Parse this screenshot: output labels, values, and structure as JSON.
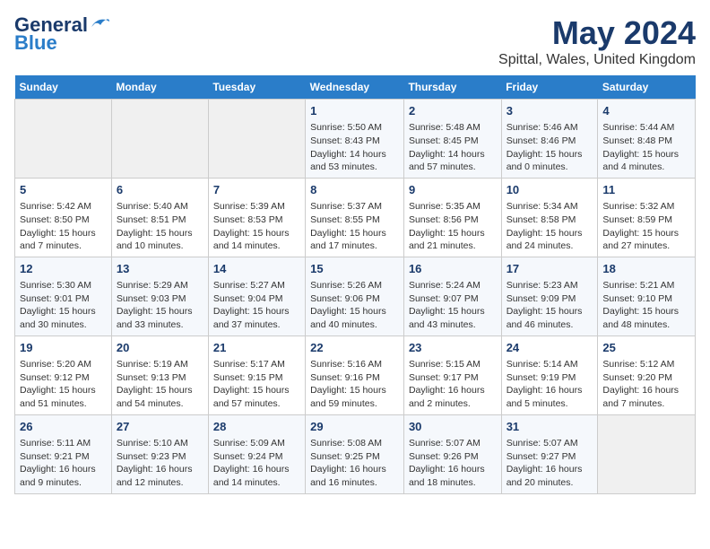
{
  "logo": {
    "line1": "General",
    "line2": "Blue"
  },
  "title": "May 2024",
  "subtitle": "Spittal, Wales, United Kingdom",
  "headers": [
    "Sunday",
    "Monday",
    "Tuesday",
    "Wednesday",
    "Thursday",
    "Friday",
    "Saturday"
  ],
  "weeks": [
    [
      {
        "day": "",
        "info": ""
      },
      {
        "day": "",
        "info": ""
      },
      {
        "day": "",
        "info": ""
      },
      {
        "day": "1",
        "info": "Sunrise: 5:50 AM\nSunset: 8:43 PM\nDaylight: 14 hours and 53 minutes."
      },
      {
        "day": "2",
        "info": "Sunrise: 5:48 AM\nSunset: 8:45 PM\nDaylight: 14 hours and 57 minutes."
      },
      {
        "day": "3",
        "info": "Sunrise: 5:46 AM\nSunset: 8:46 PM\nDaylight: 15 hours and 0 minutes."
      },
      {
        "day": "4",
        "info": "Sunrise: 5:44 AM\nSunset: 8:48 PM\nDaylight: 15 hours and 4 minutes."
      }
    ],
    [
      {
        "day": "5",
        "info": "Sunrise: 5:42 AM\nSunset: 8:50 PM\nDaylight: 15 hours and 7 minutes."
      },
      {
        "day": "6",
        "info": "Sunrise: 5:40 AM\nSunset: 8:51 PM\nDaylight: 15 hours and 10 minutes."
      },
      {
        "day": "7",
        "info": "Sunrise: 5:39 AM\nSunset: 8:53 PM\nDaylight: 15 hours and 14 minutes."
      },
      {
        "day": "8",
        "info": "Sunrise: 5:37 AM\nSunset: 8:55 PM\nDaylight: 15 hours and 17 minutes."
      },
      {
        "day": "9",
        "info": "Sunrise: 5:35 AM\nSunset: 8:56 PM\nDaylight: 15 hours and 21 minutes."
      },
      {
        "day": "10",
        "info": "Sunrise: 5:34 AM\nSunset: 8:58 PM\nDaylight: 15 hours and 24 minutes."
      },
      {
        "day": "11",
        "info": "Sunrise: 5:32 AM\nSunset: 8:59 PM\nDaylight: 15 hours and 27 minutes."
      }
    ],
    [
      {
        "day": "12",
        "info": "Sunrise: 5:30 AM\nSunset: 9:01 PM\nDaylight: 15 hours and 30 minutes."
      },
      {
        "day": "13",
        "info": "Sunrise: 5:29 AM\nSunset: 9:03 PM\nDaylight: 15 hours and 33 minutes."
      },
      {
        "day": "14",
        "info": "Sunrise: 5:27 AM\nSunset: 9:04 PM\nDaylight: 15 hours and 37 minutes."
      },
      {
        "day": "15",
        "info": "Sunrise: 5:26 AM\nSunset: 9:06 PM\nDaylight: 15 hours and 40 minutes."
      },
      {
        "day": "16",
        "info": "Sunrise: 5:24 AM\nSunset: 9:07 PM\nDaylight: 15 hours and 43 minutes."
      },
      {
        "day": "17",
        "info": "Sunrise: 5:23 AM\nSunset: 9:09 PM\nDaylight: 15 hours and 46 minutes."
      },
      {
        "day": "18",
        "info": "Sunrise: 5:21 AM\nSunset: 9:10 PM\nDaylight: 15 hours and 48 minutes."
      }
    ],
    [
      {
        "day": "19",
        "info": "Sunrise: 5:20 AM\nSunset: 9:12 PM\nDaylight: 15 hours and 51 minutes."
      },
      {
        "day": "20",
        "info": "Sunrise: 5:19 AM\nSunset: 9:13 PM\nDaylight: 15 hours and 54 minutes."
      },
      {
        "day": "21",
        "info": "Sunrise: 5:17 AM\nSunset: 9:15 PM\nDaylight: 15 hours and 57 minutes."
      },
      {
        "day": "22",
        "info": "Sunrise: 5:16 AM\nSunset: 9:16 PM\nDaylight: 15 hours and 59 minutes."
      },
      {
        "day": "23",
        "info": "Sunrise: 5:15 AM\nSunset: 9:17 PM\nDaylight: 16 hours and 2 minutes."
      },
      {
        "day": "24",
        "info": "Sunrise: 5:14 AM\nSunset: 9:19 PM\nDaylight: 16 hours and 5 minutes."
      },
      {
        "day": "25",
        "info": "Sunrise: 5:12 AM\nSunset: 9:20 PM\nDaylight: 16 hours and 7 minutes."
      }
    ],
    [
      {
        "day": "26",
        "info": "Sunrise: 5:11 AM\nSunset: 9:21 PM\nDaylight: 16 hours and 9 minutes."
      },
      {
        "day": "27",
        "info": "Sunrise: 5:10 AM\nSunset: 9:23 PM\nDaylight: 16 hours and 12 minutes."
      },
      {
        "day": "28",
        "info": "Sunrise: 5:09 AM\nSunset: 9:24 PM\nDaylight: 16 hours and 14 minutes."
      },
      {
        "day": "29",
        "info": "Sunrise: 5:08 AM\nSunset: 9:25 PM\nDaylight: 16 hours and 16 minutes."
      },
      {
        "day": "30",
        "info": "Sunrise: 5:07 AM\nSunset: 9:26 PM\nDaylight: 16 hours and 18 minutes."
      },
      {
        "day": "31",
        "info": "Sunrise: 5:07 AM\nSunset: 9:27 PM\nDaylight: 16 hours and 20 minutes."
      },
      {
        "day": "",
        "info": ""
      }
    ]
  ]
}
